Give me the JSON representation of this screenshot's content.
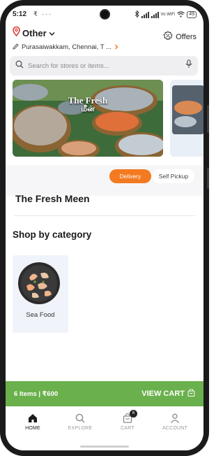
{
  "status_bar": {
    "time": "5:12",
    "left_icons": "₹ ···",
    "network": "Vo WiFi",
    "battery": "49"
  },
  "header": {
    "location_title": "Other",
    "address": "Purasaiwakkam, Chennai, T ...",
    "offers_label": "Offers"
  },
  "search": {
    "placeholder": "Search for stores or items..."
  },
  "banner": {
    "title": "The Fresh",
    "subtitle": "மீன்"
  },
  "delivery_mode": {
    "options": [
      "Delivery",
      "Self Pickup"
    ],
    "selected": "Delivery"
  },
  "store": {
    "name": "The Fresh Meen"
  },
  "categories": {
    "title": "Shop by category",
    "items": [
      {
        "label": "Sea Food"
      }
    ]
  },
  "cart": {
    "summary": "6 Items | ₹600",
    "action_label": "VIEW CART"
  },
  "bottom_nav": {
    "items": [
      {
        "label": "HOME",
        "icon": "home-icon",
        "active": true
      },
      {
        "label": "EXPLORE",
        "icon": "search-icon",
        "active": false
      },
      {
        "label": "CART",
        "icon": "bag-icon",
        "active": false,
        "badge": "6"
      },
      {
        "label": "ACCOUNT",
        "icon": "user-icon",
        "active": false
      }
    ]
  },
  "colors": {
    "accent_orange": "#f37a20",
    "cart_green": "#6ab04c",
    "search_bg": "#efeff1"
  }
}
